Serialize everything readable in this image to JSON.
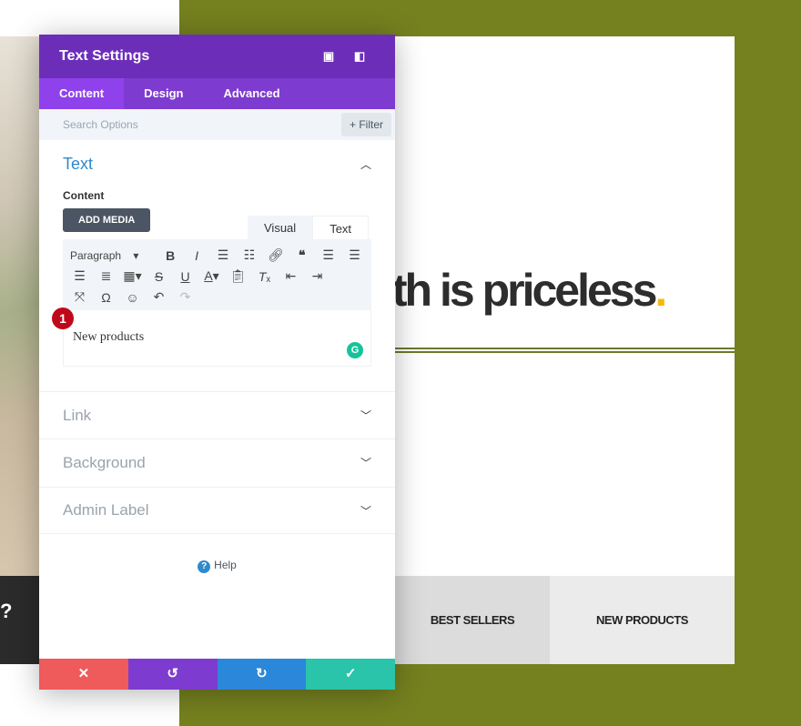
{
  "background": {
    "headline": "lth is priceless",
    "headline_dot": ".",
    "left_bar_text": "?",
    "tabs": [
      "BEST SELLERS",
      "NEW PRODUCTS"
    ]
  },
  "panel": {
    "title": "Text Settings",
    "header_icons": [
      "expand-icon",
      "sidebar-icon"
    ],
    "tabs": [
      "Content",
      "Design",
      "Advanced"
    ],
    "active_tab": "Content",
    "search_placeholder": "Search Options",
    "filter_label": "+ Filter",
    "text_section": {
      "title": "Text",
      "content_label": "Content",
      "add_media": "ADD MEDIA",
      "editor_tabs": [
        "Visual",
        "Text"
      ],
      "format_select": "Paragraph",
      "content": "New products",
      "badge": "1"
    },
    "sections": [
      "Link",
      "Background",
      "Admin Label"
    ],
    "help": "Help"
  },
  "colors": {
    "purple": "#6c2eb9",
    "olive": "#75801f",
    "cancel": "#ef5a5a",
    "undo": "#7e3bd0",
    "redo": "#2b87da",
    "save": "#29c4a9"
  }
}
